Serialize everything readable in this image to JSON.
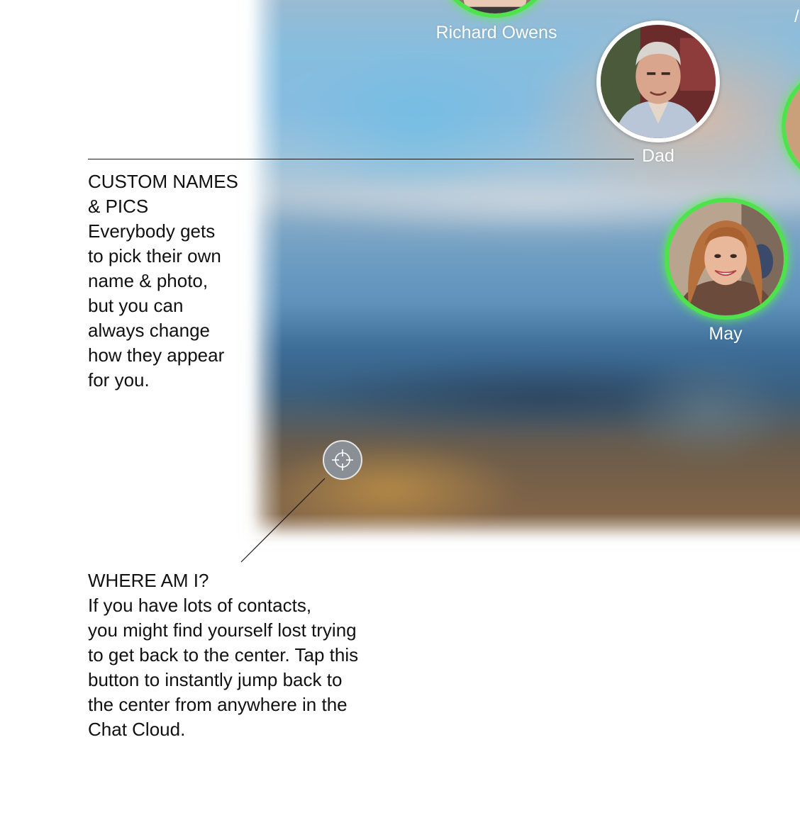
{
  "contacts": [
    {
      "name": "Richard Owens",
      "status": "online",
      "avatar_icon": "person-photo-icon"
    },
    {
      "name": "Dad",
      "status": "offline",
      "avatar_icon": "person-photo-icon"
    },
    {
      "name": "May",
      "status": "online",
      "avatar_icon": "person-photo-icon"
    }
  ],
  "colors": {
    "online_ring": "#4ee34a",
    "offline_ring": "#ffffff",
    "label_text": "#ffffff",
    "annotation_text": "#111111",
    "locate_button": "#8a8f95"
  },
  "locate_button": {
    "icon": "crosshair-icon"
  },
  "annotations": {
    "custom_names": {
      "heading_line1": "CUSTOM NAMES",
      "heading_line2": "& PICS",
      "body_lines": [
        "Everybody gets",
        "to pick their own",
        "name & photo,",
        "but you can",
        "always change",
        "how they appear",
        "for you."
      ]
    },
    "where_am_i": {
      "heading": "WHERE AM I?",
      "body_lines": [
        "If you have lots of contacts,",
        "you might find yourself lost trying",
        "to get back to the center. Tap this",
        "button to instantly jump back to",
        "the center from anywhere in the",
        "Chat Cloud."
      ]
    }
  }
}
